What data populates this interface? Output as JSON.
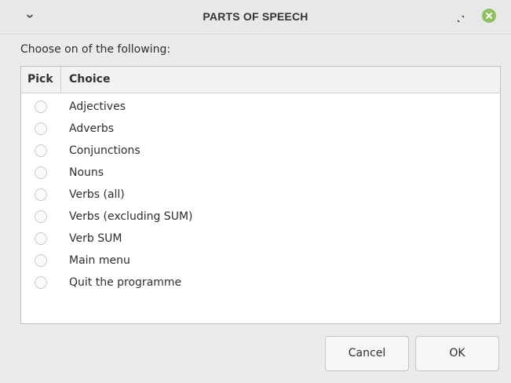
{
  "window": {
    "title": "PARTS OF SPEECH",
    "close_color": "#8fbf5e"
  },
  "prompt": "Choose on of the following:",
  "list": {
    "columns": [
      "Pick",
      "Choice"
    ],
    "items": [
      {
        "label": "Adjectives",
        "selected": false
      },
      {
        "label": "Adverbs",
        "selected": false
      },
      {
        "label": "Conjunctions",
        "selected": false
      },
      {
        "label": "Nouns",
        "selected": false
      },
      {
        "label": "Verbs (all)",
        "selected": false
      },
      {
        "label": "Verbs (excluding SUM)",
        "selected": false
      },
      {
        "label": "Verb SUM",
        "selected": false
      },
      {
        "label": "Main menu",
        "selected": false
      },
      {
        "label": "Quit the programme",
        "selected": false
      }
    ]
  },
  "buttons": {
    "cancel": "Cancel",
    "ok": "OK"
  }
}
